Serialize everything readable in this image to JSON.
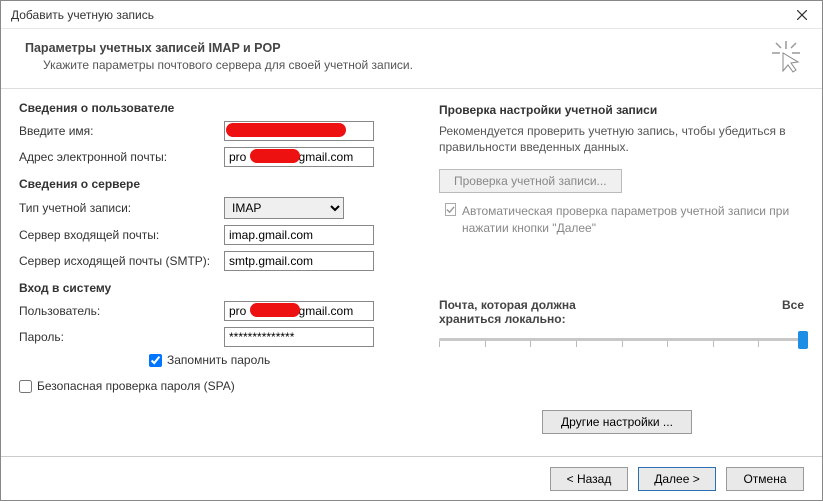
{
  "window": {
    "title": "Добавить учетную запись"
  },
  "header": {
    "title": "Параметры учетных записей IMAP и POP",
    "subtitle": "Укажите параметры почтового сервера для своей учетной записи."
  },
  "left": {
    "userSection": "Сведения о пользователе",
    "nameLabel": "Введите имя:",
    "nameValue": "",
    "emailLabel": "Адрес электронной почты:",
    "emailValue": "pro            @gmail.com",
    "serverSection": "Сведения о сервере",
    "acctTypeLabel": "Тип учетной записи:",
    "acctTypeValue": "IMAP",
    "incomingLabel": "Сервер входящей почты:",
    "incomingValue": "imap.gmail.com",
    "outgoingLabel": "Сервер исходящей почты (SMTP):",
    "outgoingValue": "smtp.gmail.com",
    "loginSection": "Вход в систему",
    "userLabel": "Пользователь:",
    "userValue": "pro            @gmail.com",
    "passLabel": "Пароль:",
    "passValue": "**************",
    "remember": "Запомнить пароль",
    "spa": "Безопасная проверка пароля (SPA)"
  },
  "right": {
    "testSection": "Проверка настройки учетной записи",
    "testNote": "Рекомендуется проверить учетную запись, чтобы убедиться в правильности введенных данных.",
    "testBtn": "Проверка учетной записи...",
    "autoCheck": "Автоматическая проверка параметров учетной записи при нажатии кнопки \"Далее\"",
    "sliderLabelLeft": "Почта, которая должна храниться локально:",
    "sliderLabelRight": "Все",
    "otherBtn": "Другие настройки ..."
  },
  "footer": {
    "back": "< Назад",
    "next": "Далее >",
    "cancel": "Отмена"
  }
}
